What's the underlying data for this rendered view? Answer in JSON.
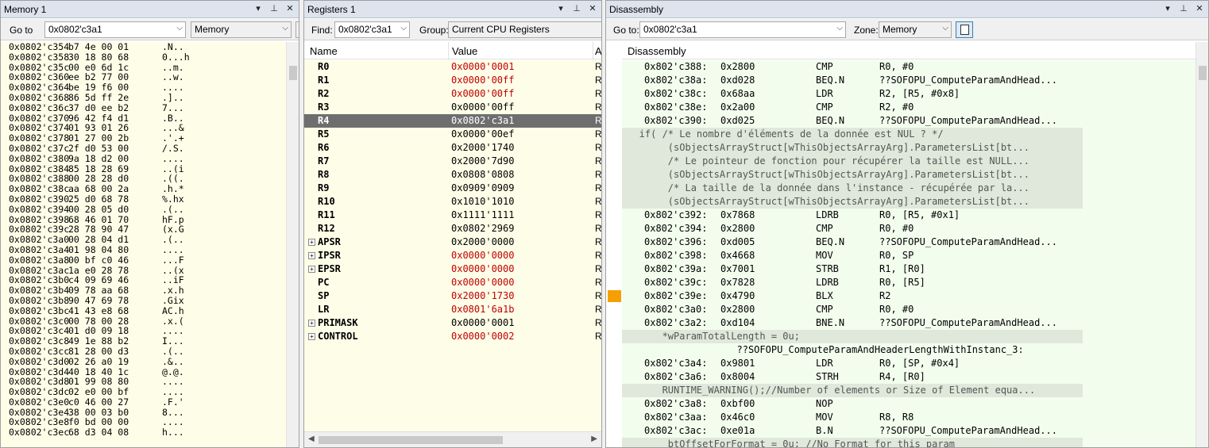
{
  "memory": {
    "title": "Memory 1",
    "goto_label": "Go to",
    "goto_value": "0x0802'c3a1",
    "zone_value": "Memory",
    "rows": [
      {
        "addr": "0x0802'c354",
        "bytes": "b7 4e 00 01",
        "ascii": ".N.."
      },
      {
        "addr": "0x0802'c358",
        "bytes": "30 18 80 68",
        "ascii": "0...h"
      },
      {
        "addr": "0x0802'c35c",
        "bytes": "00 e0 6d 1c",
        "ascii": "..m."
      },
      {
        "addr": "0x0802'c360",
        "bytes": "ee b2 77 00",
        "ascii": "..w."
      },
      {
        "addr": "0x0802'c364",
        "bytes": "be 19 f6 00",
        "ascii": "...."
      },
      {
        "addr": "0x0802'c368",
        "bytes": "86 5d ff 2e",
        "ascii": ".].."
      },
      {
        "addr": "0x0802'c36c",
        "bytes": "37 d0 ee b2",
        "ascii": "7..."
      },
      {
        "addr": "0x0802'c370",
        "bytes": "96 42 f4 d1",
        "ascii": ".B.."
      },
      {
        "addr": "0x0802'c374",
        "bytes": "01 93 01 26",
        "ascii": "...&"
      },
      {
        "addr": "0x0802'c378",
        "bytes": "01 27 00 2b",
        "ascii": ".'.+"
      },
      {
        "addr": "0x0802'c37c",
        "bytes": "2f d0 53 00",
        "ascii": "/.S."
      },
      {
        "addr": "0x0802'c380",
        "bytes": "9a 18 d2 00",
        "ascii": "...."
      },
      {
        "addr": "0x0802'c384",
        "bytes": "85 18 28 69",
        "ascii": "..(i"
      },
      {
        "addr": "0x0802'c388",
        "bytes": "00 28 28 d0",
        "ascii": ".((."
      },
      {
        "addr": "0x0802'c38c",
        "bytes": "aa 68 00 2a",
        "ascii": ".h.*"
      },
      {
        "addr": "0x0802'c390",
        "bytes": "25 d0 68 78",
        "ascii": "%.hx"
      },
      {
        "addr": "0x0802'c394",
        "bytes": "00 28 05 d0",
        "ascii": ".(.."
      },
      {
        "addr": "0x0802'c398",
        "bytes": "68 46 01 70",
        "ascii": "hF.p"
      },
      {
        "addr": "0x0802'c39c",
        "bytes": "28 78 90 47",
        "ascii": "(x.G"
      },
      {
        "addr": "0x0802'c3a0",
        "bytes": "00 28 04 d1",
        "ascii": ".(.."
      },
      {
        "addr": "0x0802'c3a4",
        "bytes": "01 98 04 80",
        "ascii": "...."
      },
      {
        "addr": "0x0802'c3a8",
        "bytes": "00 bf c0 46",
        "ascii": "...F"
      },
      {
        "addr": "0x0802'c3ac",
        "bytes": "1a e0 28 78",
        "ascii": "..(x"
      },
      {
        "addr": "0x0802'c3b0",
        "bytes": "c4 09 69 46",
        "ascii": "..iF"
      },
      {
        "addr": "0x0802'c3b4",
        "bytes": "09 78 aa 68",
        "ascii": ".x.h"
      },
      {
        "addr": "0x0802'c3b8",
        "bytes": "90 47 69 78",
        "ascii": ".Gix"
      },
      {
        "addr": "0x0802'c3bc",
        "bytes": "41 43 e8 68",
        "ascii": "AC.h"
      },
      {
        "addr": "0x0802'c3c0",
        "bytes": "00 78 00 28",
        "ascii": ".x.("
      },
      {
        "addr": "0x0802'c3c4",
        "bytes": "01 d0 09 18",
        "ascii": "...."
      },
      {
        "addr": "0x0802'c3c8",
        "bytes": "49 1e 88 b2",
        "ascii": "I..."
      },
      {
        "addr": "0x0802'c3cc",
        "bytes": "81 28 00 d3",
        "ascii": ".(.."
      },
      {
        "addr": "0x0802'c3d0",
        "bytes": "02 26 a0 19",
        "ascii": ".&.."
      },
      {
        "addr": "0x0802'c3d4",
        "bytes": "40 18 40 1c",
        "ascii": "@.@."
      },
      {
        "addr": "0x0802'c3d8",
        "bytes": "01 99 08 80",
        "ascii": "...."
      },
      {
        "addr": "0x0802'c3dc",
        "bytes": "02 e0 00 bf",
        "ascii": "...."
      },
      {
        "addr": "0x0802'c3e0",
        "bytes": "c0 46 00 27",
        "ascii": ".F.'"
      },
      {
        "addr": "0x0802'c3e4",
        "bytes": "38 00 03 b0",
        "ascii": "8..."
      },
      {
        "addr": "0x0802'c3e8",
        "bytes": "f0 bd 00 00",
        "ascii": "...."
      },
      {
        "addr": "0x0802'c3ec",
        "bytes": "68 d3 04 08",
        "ascii": "h..."
      }
    ]
  },
  "registers": {
    "title": "Registers 1",
    "find_label": "Find:",
    "find_value": "0x0802'c3a1",
    "group_label": "Group:",
    "group_value": "Current CPU Registers",
    "columns": [
      "Name",
      "Value",
      "A"
    ],
    "rows": [
      {
        "name": "R0",
        "value": "0x0000'0001",
        "changed": true,
        "expandable": false,
        "access": "R"
      },
      {
        "name": "R1",
        "value": "0x0000'00ff",
        "changed": true,
        "expandable": false,
        "access": "R"
      },
      {
        "name": "R2",
        "value": "0x0000'00ff",
        "changed": true,
        "expandable": false,
        "access": "R"
      },
      {
        "name": "R3",
        "value": "0x0000'00ff",
        "changed": false,
        "expandable": false,
        "access": "R"
      },
      {
        "name": "R4",
        "value": "0x0802'c3a1",
        "changed": false,
        "expandable": false,
        "access": "R",
        "selected": true
      },
      {
        "name": "R5",
        "value": "0x0000'00ef",
        "changed": false,
        "expandable": false,
        "access": "R"
      },
      {
        "name": "R6",
        "value": "0x2000'1740",
        "changed": false,
        "expandable": false,
        "access": "R"
      },
      {
        "name": "R7",
        "value": "0x2000'7d90",
        "changed": false,
        "expandable": false,
        "access": "R"
      },
      {
        "name": "R8",
        "value": "0x0808'0808",
        "changed": false,
        "expandable": false,
        "access": "R"
      },
      {
        "name": "R9",
        "value": "0x0909'0909",
        "changed": false,
        "expandable": false,
        "access": "R"
      },
      {
        "name": "R10",
        "value": "0x1010'1010",
        "changed": false,
        "expandable": false,
        "access": "R"
      },
      {
        "name": "R11",
        "value": "0x1111'1111",
        "changed": false,
        "expandable": false,
        "access": "R"
      },
      {
        "name": "R12",
        "value": "0x0802'2969",
        "changed": false,
        "expandable": false,
        "access": "R"
      },
      {
        "name": "APSR",
        "value": "0x2000'0000",
        "changed": false,
        "expandable": true,
        "access": "R"
      },
      {
        "name": "IPSR",
        "value": "0x0000'0000",
        "changed": true,
        "expandable": true,
        "access": "R"
      },
      {
        "name": "EPSR",
        "value": "0x0000'0000",
        "changed": true,
        "expandable": true,
        "access": "R"
      },
      {
        "name": "PC",
        "value": "0x0000'0000",
        "changed": true,
        "expandable": false,
        "access": "R"
      },
      {
        "name": "SP",
        "value": "0x2000'1730",
        "changed": true,
        "expandable": false,
        "access": "R"
      },
      {
        "name": "LR",
        "value": "0x0801'6a1b",
        "changed": true,
        "expandable": false,
        "access": "R"
      },
      {
        "name": "PRIMASK",
        "value": "0x0000'0001",
        "changed": false,
        "expandable": true,
        "access": "R"
      },
      {
        "name": "CONTROL",
        "value": "0x0000'0002",
        "changed": true,
        "expandable": true,
        "access": "R"
      }
    ]
  },
  "disasm": {
    "title": "Disassembly",
    "goto_label": "Go to:",
    "goto_value": "0x0802'c3a1",
    "zone_label": "Zone:",
    "zone_value": "Memory",
    "column_header": "Disassembly",
    "breakpoint_row": 17,
    "rows": [
      {
        "kind": "asm",
        "addr": "0x802'c388:",
        "code": "0x2800",
        "mn": "CMP",
        "op": "R0, #0"
      },
      {
        "kind": "asm",
        "addr": "0x802'c38a:",
        "code": "0xd028",
        "mn": "BEQ.N",
        "op": "??SOFOPU_ComputeParamAndHead..."
      },
      {
        "kind": "asm",
        "addr": "0x802'c38c:",
        "code": "0x68aa",
        "mn": "LDR",
        "op": "R2, [R5, #0x8]"
      },
      {
        "kind": "asm",
        "addr": "0x802'c38e:",
        "code": "0x2a00",
        "mn": "CMP",
        "op": "R2, #0"
      },
      {
        "kind": "asm",
        "addr": "0x802'c390:",
        "code": "0xd025",
        "mn": "BEQ.N",
        "op": "??SOFOPU_ComputeParamAndHead..."
      },
      {
        "kind": "src",
        "text": "   if( /* Le nombre d'éléments de la donnée est NUL ? */"
      },
      {
        "kind": "src",
        "text": "        (sObjectsArrayStruct[wThisObjectsArrayArg].ParametersList[bt..."
      },
      {
        "kind": "src",
        "text": "        /* Le pointeur de fonction pour récupérer la taille est NULL..."
      },
      {
        "kind": "src",
        "text": "        (sObjectsArrayStruct[wThisObjectsArrayArg].ParametersList[bt..."
      },
      {
        "kind": "src",
        "text": "        /* La taille de la donnée dans l'instance - récupérée par la..."
      },
      {
        "kind": "src",
        "text": "        (sObjectsArrayStruct[wThisObjectsArrayArg].ParametersList[bt..."
      },
      {
        "kind": "asm",
        "addr": "0x802'c392:",
        "code": "0x7868",
        "mn": "LDRB",
        "op": "R0, [R5, #0x1]"
      },
      {
        "kind": "asm",
        "addr": "0x802'c394:",
        "code": "0x2800",
        "mn": "CMP",
        "op": "R0, #0"
      },
      {
        "kind": "asm",
        "addr": "0x802'c396:",
        "code": "0xd005",
        "mn": "BEQ.N",
        "op": "??SOFOPU_ComputeParamAndHead..."
      },
      {
        "kind": "asm",
        "addr": "0x802'c398:",
        "code": "0x4668",
        "mn": "MOV",
        "op": "R0, SP"
      },
      {
        "kind": "asm",
        "addr": "0x802'c39a:",
        "code": "0x7001",
        "mn": "STRB",
        "op": "R1, [R0]"
      },
      {
        "kind": "asm",
        "addr": "0x802'c39c:",
        "code": "0x7828",
        "mn": "LDRB",
        "op": "R0, [R5]"
      },
      {
        "kind": "asm",
        "addr": "0x802'c39e:",
        "code": "0x4790",
        "mn": "BLX",
        "op": "R2"
      },
      {
        "kind": "asm",
        "addr": "0x802'c3a0:",
        "code": "0x2800",
        "mn": "CMP",
        "op": "R0, #0"
      },
      {
        "kind": "asm",
        "addr": "0x802'c3a2:",
        "code": "0xd104",
        "mn": "BNE.N",
        "op": "??SOFOPU_ComputeParamAndHead..."
      },
      {
        "kind": "src",
        "text": "       *wParamTotalLength = 0u;"
      },
      {
        "kind": "lbl",
        "text": "                    ??SOFOPU_ComputeParamAndHeaderLengthWithInstanc_3:"
      },
      {
        "kind": "asm",
        "addr": "0x802'c3a4:",
        "code": "0x9801",
        "mn": "LDR",
        "op": "R0, [SP, #0x4]"
      },
      {
        "kind": "asm",
        "addr": "0x802'c3a6:",
        "code": "0x8004",
        "mn": "STRH",
        "op": "R4, [R0]"
      },
      {
        "kind": "src",
        "text": "       RUNTIME_WARNING();//Number of elements or Size of Element equa..."
      },
      {
        "kind": "asm",
        "addr": "0x802'c3a8:",
        "code": "0xbf00",
        "mn": "NOP",
        "op": ""
      },
      {
        "kind": "asm",
        "addr": "0x802'c3aa:",
        "code": "0x46c0",
        "mn": "MOV",
        "op": "R8, R8"
      },
      {
        "kind": "asm",
        "addr": "0x802'c3ac:",
        "code": "0xe01a",
        "mn": "B.N",
        "op": "??SOFOPU_ComputeParamAndHead..."
      },
      {
        "kind": "src",
        "text": "        btOffsetForFormat = 0u; //No Format for this param"
      }
    ]
  }
}
